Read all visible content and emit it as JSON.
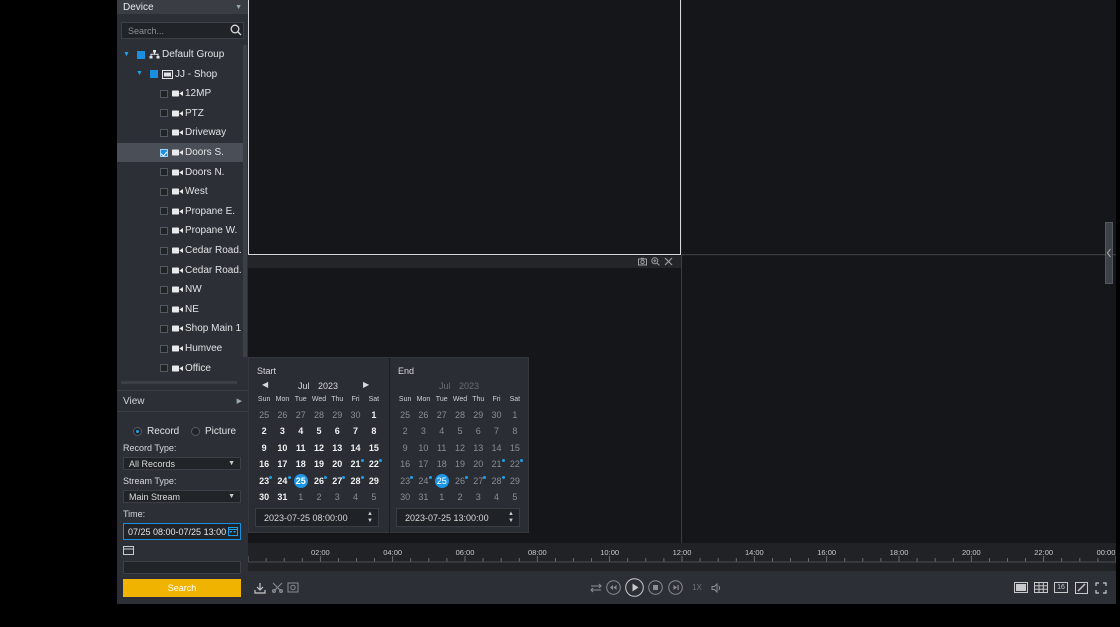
{
  "sidebar": {
    "device_title": "Device",
    "search_placeholder": "Search...",
    "tree": [
      {
        "label": "Default Group",
        "level": 0,
        "type": "group",
        "checked": "partial"
      },
      {
        "label": "JJ - Shop",
        "level": 1,
        "type": "nvr",
        "checked": "partial"
      },
      {
        "label": "12MP",
        "level": 2,
        "type": "camera",
        "checked": false
      },
      {
        "label": "PTZ",
        "level": 2,
        "type": "camera",
        "checked": false
      },
      {
        "label": "Driveway",
        "level": 2,
        "type": "camera",
        "checked": false
      },
      {
        "label": "Doors S.",
        "level": 2,
        "type": "camera",
        "checked": true
      },
      {
        "label": "Doors N.",
        "level": 2,
        "type": "camera",
        "checked": false
      },
      {
        "label": "West",
        "level": 2,
        "type": "camera",
        "checked": false
      },
      {
        "label": "Propane E.",
        "level": 2,
        "type": "camera",
        "checked": false
      },
      {
        "label": "Propane W.",
        "level": 2,
        "type": "camera",
        "checked": false
      },
      {
        "label": "Cedar Road.",
        "level": 2,
        "type": "camera",
        "checked": false
      },
      {
        "label": "Cedar Road.",
        "level": 2,
        "type": "camera",
        "checked": false
      },
      {
        "label": "NW",
        "level": 2,
        "type": "camera",
        "checked": false
      },
      {
        "label": "NE",
        "level": 2,
        "type": "camera",
        "checked": false
      },
      {
        "label": "Shop Main 1",
        "level": 2,
        "type": "camera",
        "checked": false
      },
      {
        "label": "Humvee",
        "level": 2,
        "type": "camera",
        "checked": false
      },
      {
        "label": "Office",
        "level": 2,
        "type": "camera",
        "checked": false
      }
    ],
    "view_label": "View",
    "mode_record": "Record",
    "mode_picture": "Picture",
    "record_type_label": "Record Type:",
    "record_type_value": "All Records",
    "stream_type_label": "Stream Type:",
    "stream_type_value": "Main Stream",
    "time_label": "Time:",
    "time_value": "07/25 08:00-07/25 13:00",
    "search_button": "Search"
  },
  "calendar": {
    "weekdays": [
      "Sun",
      "Mon",
      "Tue",
      "Wed",
      "Thu",
      "Fri",
      "Sat"
    ],
    "start": {
      "title": "Start",
      "month": "Jul",
      "year": "2023",
      "datetime": "2023-07-25 08:00:00",
      "weeks": [
        [
          {
            "d": "25",
            "o": 1
          },
          {
            "d": "26",
            "o": 1
          },
          {
            "d": "27",
            "o": 1
          },
          {
            "d": "28",
            "o": 1
          },
          {
            "d": "29",
            "o": 1
          },
          {
            "d": "30",
            "o": 1
          },
          {
            "d": "1"
          }
        ],
        [
          {
            "d": "2"
          },
          {
            "d": "3"
          },
          {
            "d": "4"
          },
          {
            "d": "5"
          },
          {
            "d": "6"
          },
          {
            "d": "7"
          },
          {
            "d": "8"
          }
        ],
        [
          {
            "d": "9"
          },
          {
            "d": "10"
          },
          {
            "d": "11"
          },
          {
            "d": "12"
          },
          {
            "d": "13"
          },
          {
            "d": "14"
          },
          {
            "d": "15"
          }
        ],
        [
          {
            "d": "16"
          },
          {
            "d": "17"
          },
          {
            "d": "18"
          },
          {
            "d": "19"
          },
          {
            "d": "20"
          },
          {
            "d": "21",
            "dot": 1
          },
          {
            "d": "22",
            "dot": 1
          }
        ],
        [
          {
            "d": "23",
            "dot": 1
          },
          {
            "d": "24",
            "dot": 1
          },
          {
            "d": "25",
            "sel": 1
          },
          {
            "d": "26",
            "dot": 1
          },
          {
            "d": "27",
            "dot": 1
          },
          {
            "d": "28",
            "dot": 1
          },
          {
            "d": "29"
          }
        ],
        [
          {
            "d": "30"
          },
          {
            "d": "31"
          },
          {
            "d": "1",
            "o": 1
          },
          {
            "d": "2",
            "o": 1
          },
          {
            "d": "3",
            "o": 1
          },
          {
            "d": "4",
            "o": 1
          },
          {
            "d": "5",
            "o": 1
          }
        ]
      ]
    },
    "end": {
      "title": "End",
      "month": "Jul",
      "year": "2023",
      "datetime": "2023-07-25 13:00:00",
      "weeks": [
        [
          {
            "d": "25",
            "o": 1
          },
          {
            "d": "26",
            "o": 1
          },
          {
            "d": "27",
            "o": 1
          },
          {
            "d": "28",
            "o": 1
          },
          {
            "d": "29",
            "o": 1
          },
          {
            "d": "30",
            "o": 1
          },
          {
            "d": "1"
          }
        ],
        [
          {
            "d": "2"
          },
          {
            "d": "3"
          },
          {
            "d": "4"
          },
          {
            "d": "5"
          },
          {
            "d": "6"
          },
          {
            "d": "7"
          },
          {
            "d": "8"
          }
        ],
        [
          {
            "d": "9"
          },
          {
            "d": "10"
          },
          {
            "d": "11"
          },
          {
            "d": "12"
          },
          {
            "d": "13"
          },
          {
            "d": "14"
          },
          {
            "d": "15"
          }
        ],
        [
          {
            "d": "16"
          },
          {
            "d": "17"
          },
          {
            "d": "18"
          },
          {
            "d": "19"
          },
          {
            "d": "20"
          },
          {
            "d": "21",
            "dot": 1
          },
          {
            "d": "22",
            "dot": 1
          }
        ],
        [
          {
            "d": "23",
            "dot": 1
          },
          {
            "d": "24",
            "dot": 1
          },
          {
            "d": "25",
            "sel": 1
          },
          {
            "d": "26",
            "dot": 1
          },
          {
            "d": "27",
            "dot": 1
          },
          {
            "d": "28",
            "dot": 1
          },
          {
            "d": "29"
          }
        ],
        [
          {
            "d": "30"
          },
          {
            "d": "31"
          },
          {
            "d": "1",
            "o": 1
          },
          {
            "d": "2",
            "o": 1
          },
          {
            "d": "3",
            "o": 1
          },
          {
            "d": "4",
            "o": 1
          },
          {
            "d": "5",
            "o": 1
          }
        ]
      ]
    }
  },
  "timeline": {
    "labels": [
      "02:00",
      "04:00",
      "06:00",
      "08:00",
      "10:00",
      "12:00",
      "14:00",
      "16:00",
      "18:00",
      "20:00",
      "22:00",
      "00:00"
    ]
  },
  "playback": {
    "speed": "1X",
    "layout_16": "16"
  },
  "colors": {
    "accent": "#1a8fe0",
    "search_button": "#f0b400"
  }
}
